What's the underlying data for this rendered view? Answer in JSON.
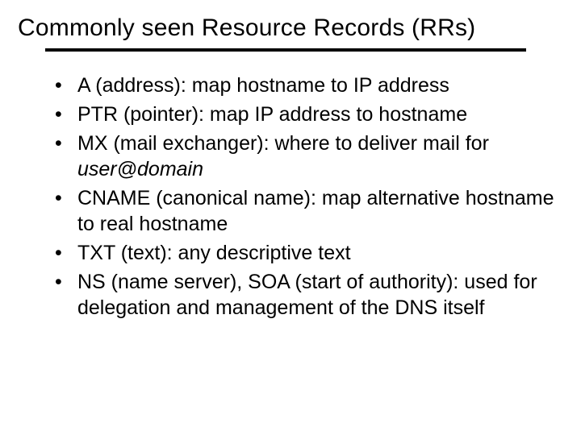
{
  "title": "Commonly seen Resource Records (RRs)",
  "bullets": {
    "b0": "A (address): map hostname to IP address",
    "b1": "PTR (pointer): map IP address to hostname",
    "b2_lead": "MX (mail exchanger): where to deliver mail for ",
    "b2_italic": "user@domain",
    "b3": "CNAME (canonical name): map alternative hostname to real hostname",
    "b4": "TXT (text): any descriptive text",
    "b5": "NS (name server), SOA (start of authority): used for delegation and management of the DNS itself"
  }
}
